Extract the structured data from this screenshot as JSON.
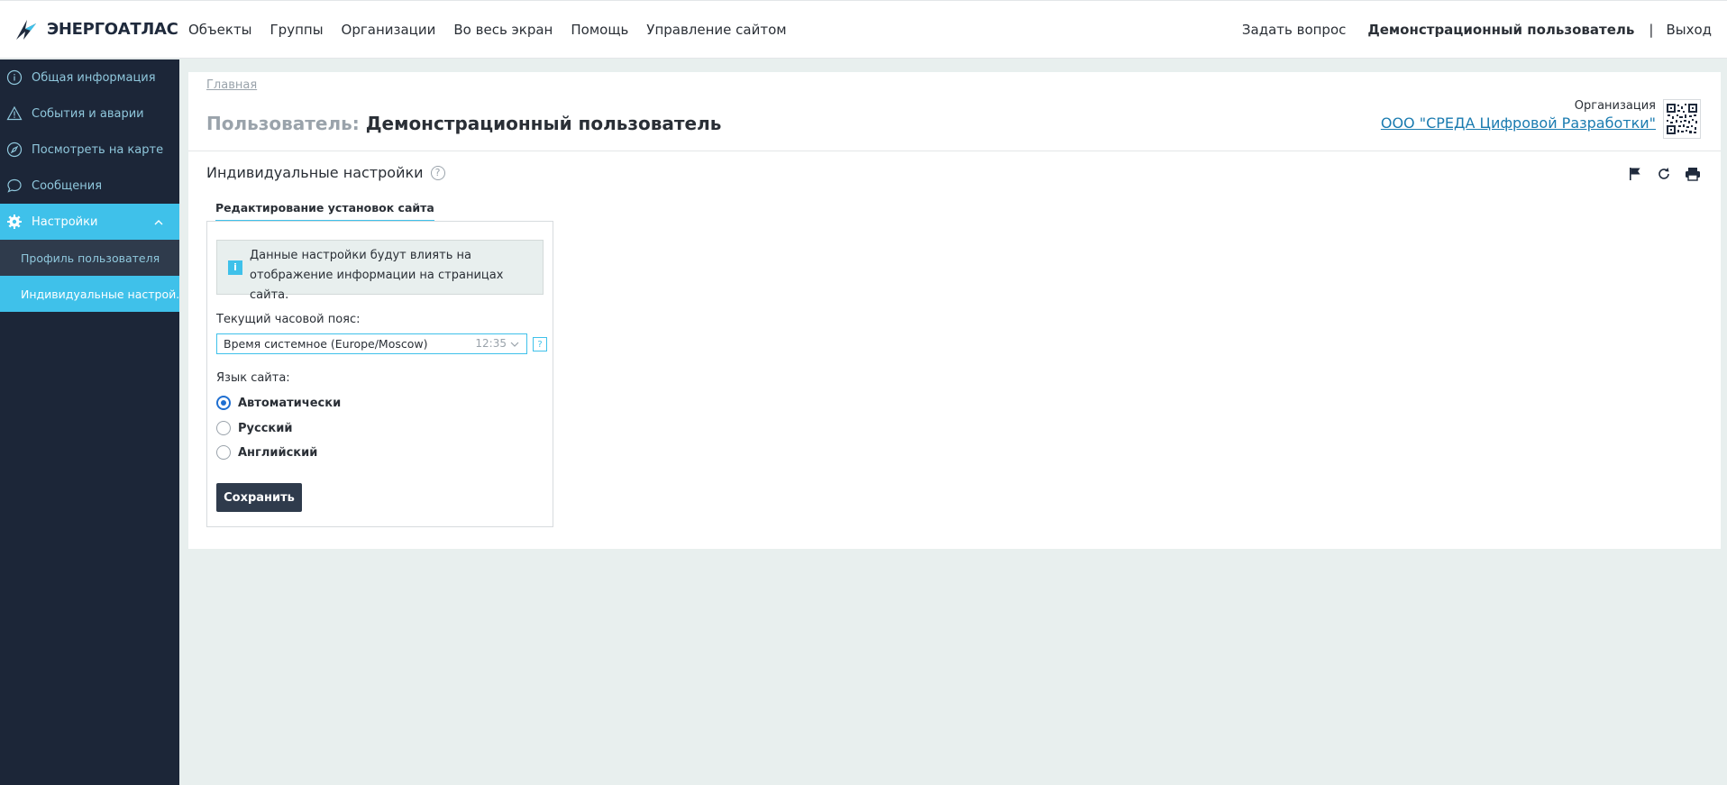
{
  "header": {
    "logo_text": "ЭНЕРГОАТЛАС",
    "nav": [
      "Объекты",
      "Группы",
      "Организации",
      "Во весь экран",
      "Помощь",
      "Управление сайтом"
    ],
    "ask_question": "Задать вопрос",
    "user_name": "Демонстрационный пользователь",
    "separator": "|",
    "logout": "Выход"
  },
  "sidebar": {
    "items": [
      {
        "label": "Общая информация",
        "icon": "info-icon"
      },
      {
        "label": "События и аварии",
        "icon": "warning-icon"
      },
      {
        "label": "Посмотреть на карте",
        "icon": "compass-icon"
      },
      {
        "label": "Сообщения",
        "icon": "chat-icon"
      },
      {
        "label": "Настройки",
        "icon": "gear-icon"
      }
    ],
    "sub_items": [
      {
        "label": "Профиль пользователя"
      },
      {
        "label": "Индивидуальные настрой..."
      }
    ]
  },
  "main": {
    "breadcrumb": "Главная",
    "title_prefix": "Пользователь:",
    "title": "Демонстрационный пользователь",
    "org_label": "Организация",
    "org_name": "ООО \"СРЕДА Цифровой Разработки\"",
    "section_title": "Индивидуальные настройки",
    "help_glyph": "?",
    "tab_label": "Редактирование установок сайта",
    "info_text": "Данные настройки будут влиять на отображение информации на страницах сайта.",
    "info_glyph": "i",
    "timezone_label": "Текущий часовой пояс:",
    "timezone_value": "Время системное (Europe/Moscow)",
    "timezone_time": "12:35",
    "timezone_help": "?",
    "language_label": "Язык сайта:",
    "language_options": [
      "Автоматически",
      "Русский",
      "Английский"
    ],
    "language_selected": 0,
    "save_label": "Сохранить"
  },
  "colors": {
    "accent": "#3fc1ea",
    "sidebar_bg": "#1c2638",
    "link": "#1a7bb0",
    "button_bg": "#2f3b4c"
  }
}
